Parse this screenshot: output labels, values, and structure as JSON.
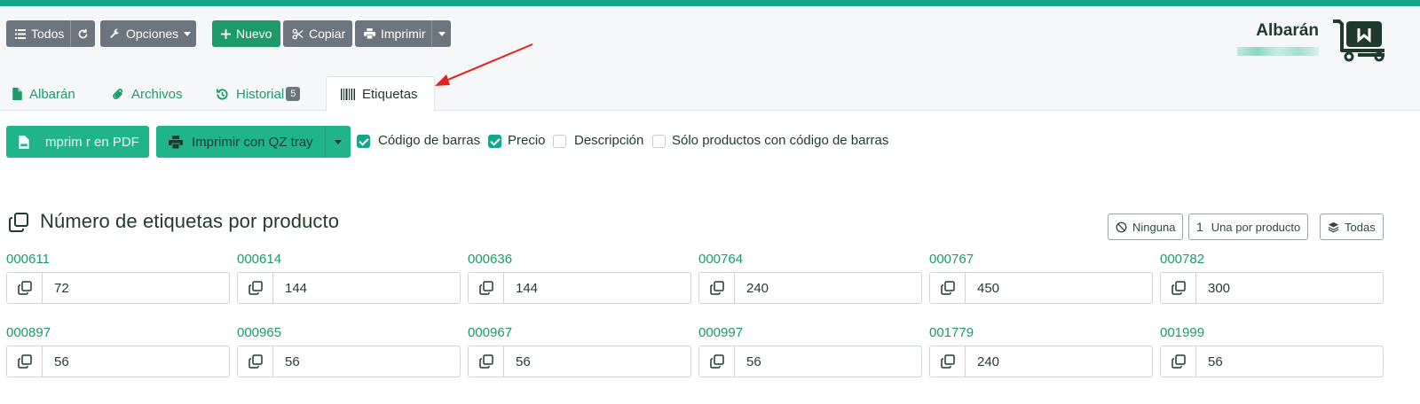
{
  "toolbar": {
    "all_label": "Todos",
    "options_label": "Opciones",
    "new_label": "Nuevo",
    "copy_label": "Copiar",
    "print_label": "Imprimir"
  },
  "document": {
    "title": "Albarán"
  },
  "tabs": [
    {
      "label": "Albarán"
    },
    {
      "label": "Archivos"
    },
    {
      "label": "Historial",
      "badge": "5"
    },
    {
      "label": "Etiquetas"
    }
  ],
  "actions": {
    "pdf_label": "mprim r en PDF",
    "qz_label": "Imprimir con QZ tray"
  },
  "options": [
    {
      "label": "Código de barras",
      "checked": true
    },
    {
      "label": "Precio",
      "checked": true
    },
    {
      "label": "Descripción",
      "checked": false
    },
    {
      "label": "Sólo productos con código de barras",
      "checked": false
    }
  ],
  "section": {
    "title": "Número de etiquetas por producto",
    "none_label": "Ninguna",
    "one_label": "Una por producto",
    "one_prefix": "1",
    "all_label": "Todas"
  },
  "products": [
    {
      "code": "000611",
      "qty": "72"
    },
    {
      "code": "000614",
      "qty": "144"
    },
    {
      "code": "000636",
      "qty": "144"
    },
    {
      "code": "000764",
      "qty": "240"
    },
    {
      "code": "000767",
      "qty": "450"
    },
    {
      "code": "000782",
      "qty": "300"
    },
    {
      "code": "000897",
      "qty": "56"
    },
    {
      "code": "000965",
      "qty": "56"
    },
    {
      "code": "000967",
      "qty": "56"
    },
    {
      "code": "000997",
      "qty": "56"
    },
    {
      "code": "001779",
      "qty": "240"
    },
    {
      "code": "001999",
      "qty": "56"
    }
  ],
  "colors": {
    "accent": "#17a589",
    "link_green": "#1e9a6a",
    "button_gray": "#6c757d",
    "arrow_red": "#e8201c"
  }
}
